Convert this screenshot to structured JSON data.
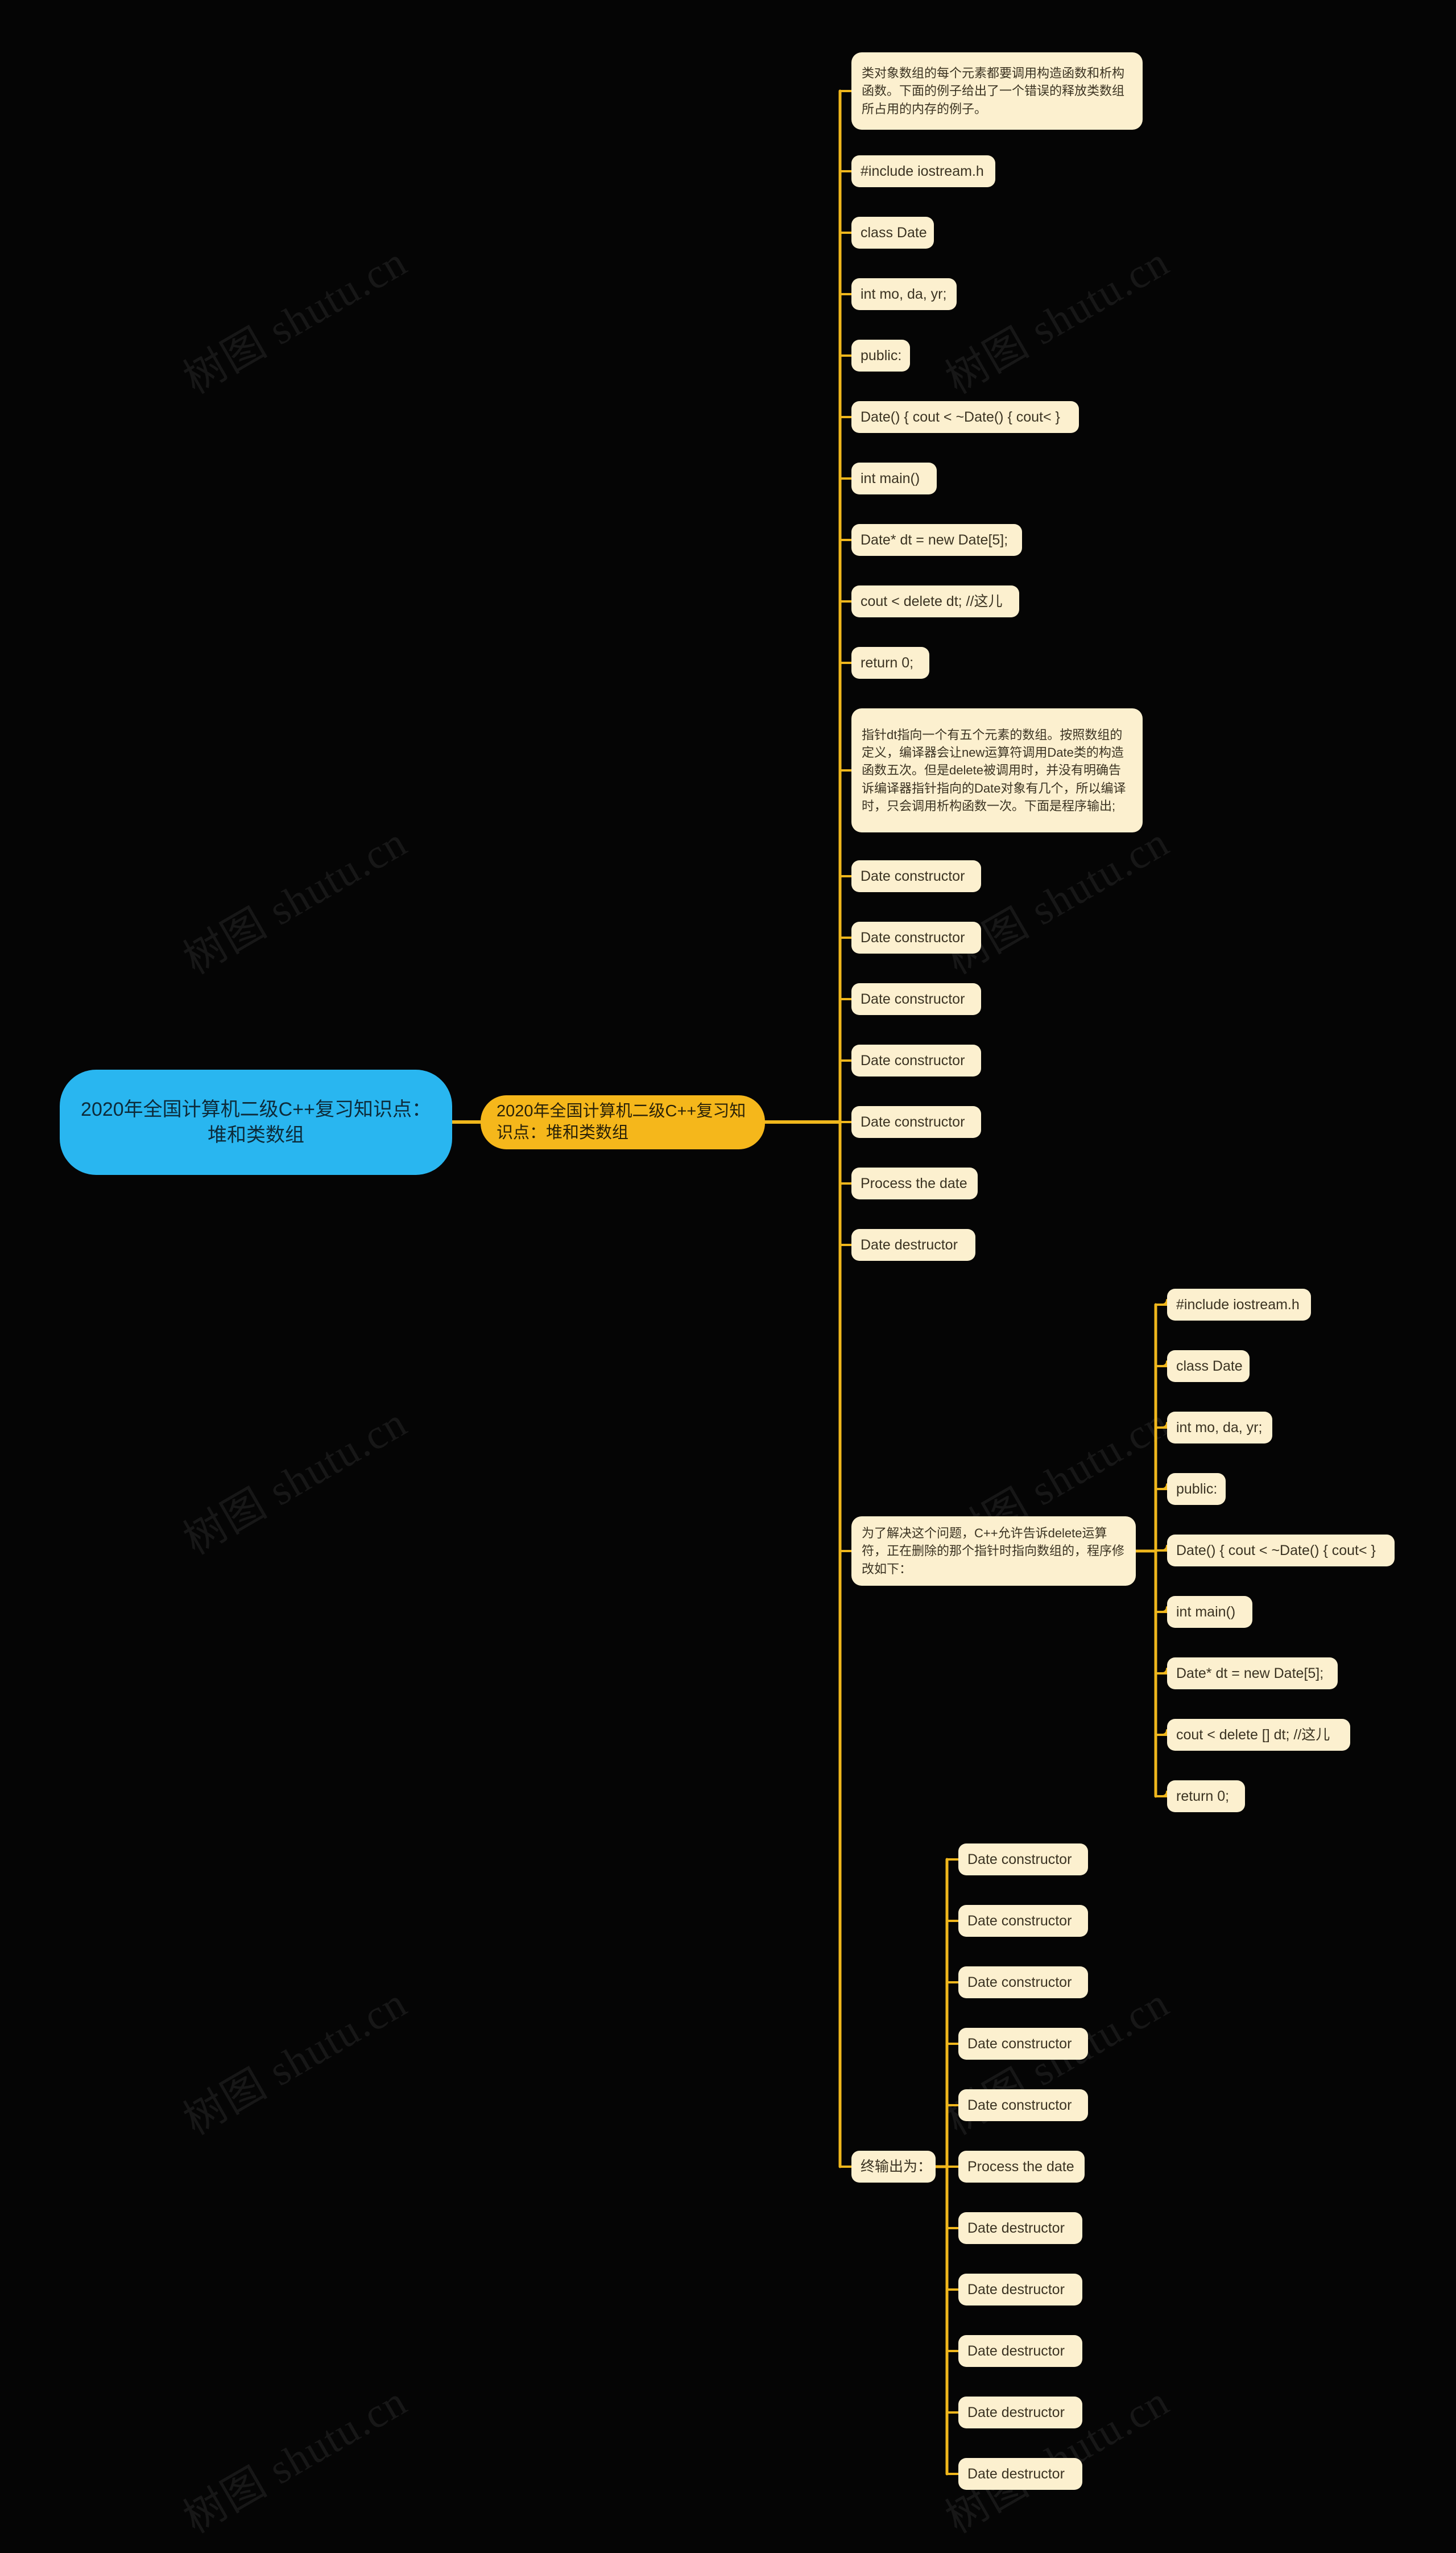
{
  "meta": {
    "background": "#000000",
    "root_color": "#29b6f0",
    "branch_color": "#f5b71b",
    "leaf_color": "#fcf0cf",
    "link_color": "#f0b71c",
    "watermark_text": "树图 shutu.cn"
  },
  "root": {
    "label": "2020年全国计算机二级C++复习知识点：堆和类数组"
  },
  "branch": {
    "label": "2020年全国计算机二级C++复习知识点：堆和类数组"
  },
  "nodes": {
    "intro_para": "类对象数组的每个元素都要调用构造函数和析构函数。下面的例子给出了一个错误的释放类数组所占用的内存的例子。",
    "code1": [
      "#include iostream.h",
      "class Date",
      "int mo, da, yr;",
      "public:",
      "Date() { cout < ~Date() { cout< }",
      "int main()",
      "Date* dt = new Date[5];",
      "cout < delete dt; //这儿",
      "return 0;"
    ],
    "explain_para": "指针dt指向一个有五个元素的数组。按照数组的定义，编译器会让new运算符调用Date类的构造函数五次。但是delete被调用时，并没有明确告诉编译器指针指向的Date对象有几个，所以编译时，只会调用析构函数一次。下面是程序输出;",
    "output1": [
      "Date constructor",
      "Date constructor",
      "Date constructor",
      "Date constructor",
      "Date constructor",
      "Process the date",
      "Date destructor"
    ],
    "fix_para": "为了解决这个问题，C++允许告诉delete运算符，正在删除的那个指针时指向数组的，程序修改如下：",
    "code2": [
      "#include iostream.h",
      "class Date",
      "int mo, da, yr;",
      "public:",
      "Date() { cout < ~Date() { cout< }",
      "int main()",
      "Date* dt = new Date[5];",
      "cout < delete [] dt; //这儿",
      "return 0;"
    ],
    "final_output_label": "终输出为：",
    "output2": [
      "Date constructor",
      "Date constructor",
      "Date constructor",
      "Date constructor",
      "Date constructor",
      "Process the date",
      "Date destructor",
      "Date destructor",
      "Date destructor",
      "Date destructor",
      "Date destructor"
    ]
  }
}
